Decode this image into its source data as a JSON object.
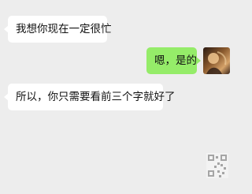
{
  "messages": [
    {
      "side": "left",
      "text": "我想你现在一定很忙"
    },
    {
      "side": "right",
      "text": "嗯，是的"
    },
    {
      "side": "left",
      "text": "所以，你只需要看前三个字就好了"
    }
  ],
  "colors": {
    "background": "#ededed",
    "incoming_bubble": "#ffffff",
    "outgoing_bubble": "#95ec69"
  },
  "icons": {
    "self_avatar": "avatar-photo-icon",
    "watermark": "qr-code-icon"
  }
}
